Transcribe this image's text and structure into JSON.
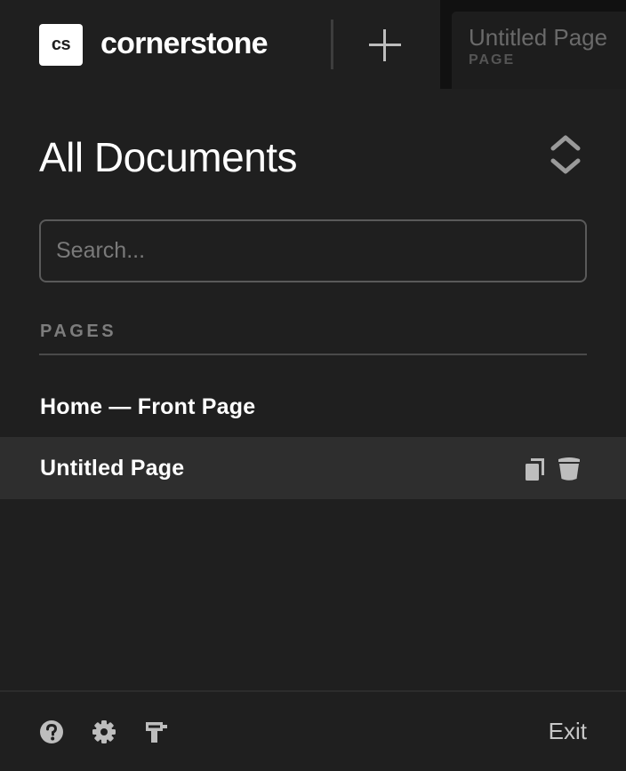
{
  "header": {
    "logo_text": "cs",
    "brand_name": "cornerstone",
    "add_label": "+"
  },
  "document_tab": {
    "title": "Untitled Page",
    "type": "PAGE"
  },
  "panel": {
    "title": "All Documents",
    "search_placeholder": "Search...",
    "section_label": "PAGES",
    "pages": [
      {
        "label": "Home — Front Page",
        "active": false
      },
      {
        "label": "Untitled Page",
        "active": true
      }
    ]
  },
  "footer": {
    "icons": [
      "help-icon",
      "settings-gear-icon",
      "builder-tool-icon"
    ],
    "exit_label": "Exit"
  },
  "colors": {
    "background": "#1f1f1f",
    "active_row": "#2e2e2e",
    "text": "#ffffff",
    "muted": "#7d7d7d"
  }
}
